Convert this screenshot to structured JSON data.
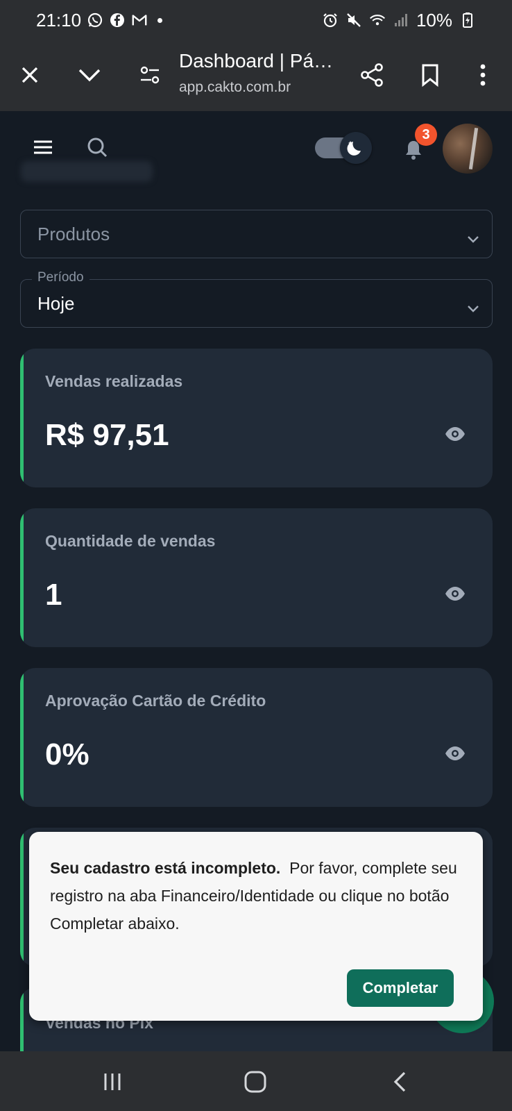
{
  "status_bar": {
    "time": "21:10",
    "battery": "10%"
  },
  "browser": {
    "title": "Dashboard | Pá…",
    "url": "app.cakto.com.br"
  },
  "header": {
    "notification_count": "3"
  },
  "filters": {
    "products_placeholder": "Produtos",
    "period_label": "Período",
    "period_value": "Hoje"
  },
  "cards": [
    {
      "label": "Vendas realizadas",
      "value": "R$ 97,51"
    },
    {
      "label": "Quantidade de vendas",
      "value": "1"
    },
    {
      "label": "Aprovação Cartão de Crédito",
      "value": "0%"
    },
    {
      "label": "Vendas no Pix",
      "value": ""
    }
  ],
  "toast": {
    "title": "Seu cadastro está incompleto.",
    "message": "Por favor, complete seu registro na aba Financeiro/Identidade ou clique no botão Completar abaixo.",
    "button": "Completar"
  },
  "colors": {
    "accent": "#2fbf71",
    "badge": "#f2542d",
    "button": "#0f6e5a",
    "background": "#141b24",
    "card": "#212b38"
  },
  "icons": [
    "whatsapp-icon",
    "facebook-icon",
    "gmail-icon",
    "alarm-icon",
    "mute-icon",
    "wifi-icon",
    "signal-icon",
    "battery-icon",
    "close-icon",
    "chevron-down-icon",
    "site-settings-icon",
    "share-icon",
    "bookmark-icon",
    "more-icon",
    "menu-icon",
    "search-icon",
    "moon-icon",
    "bell-icon",
    "eye-icon",
    "recents-icon",
    "home-icon",
    "back-icon"
  ]
}
